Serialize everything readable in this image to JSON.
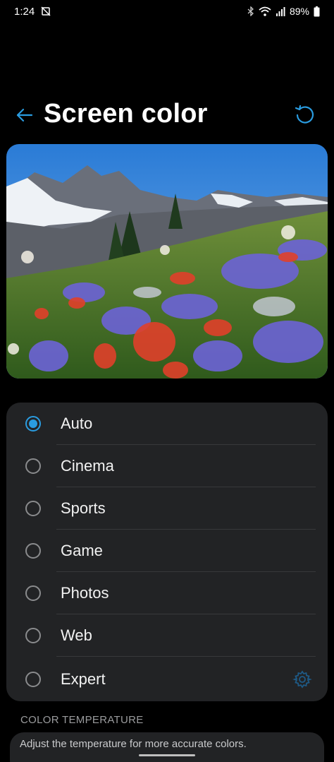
{
  "status_bar": {
    "time": "1:24",
    "battery": "89%",
    "icons": [
      "do-not-disturb-icon",
      "bluetooth-icon",
      "wifi-icon",
      "signal-icon",
      "battery-icon"
    ]
  },
  "header": {
    "title": "Screen color",
    "back_icon": "back-arrow-icon",
    "reset_icon": "reset-icon"
  },
  "preview": {
    "description_icon": "landscape-preview-image"
  },
  "options": [
    {
      "label": "Auto",
      "selected": true
    },
    {
      "label": "Cinema",
      "selected": false
    },
    {
      "label": "Sports",
      "selected": false
    },
    {
      "label": "Game",
      "selected": false
    },
    {
      "label": "Photos",
      "selected": false
    },
    {
      "label": "Web",
      "selected": false
    },
    {
      "label": "Expert",
      "selected": false,
      "has_settings": true
    }
  ],
  "color_temperature": {
    "header": "COLOR TEMPERATURE",
    "description": "Adjust the temperature for more accurate colors."
  },
  "colors": {
    "accent": "#2a9ce0",
    "card_bg": "#222325",
    "background": "#000000"
  }
}
